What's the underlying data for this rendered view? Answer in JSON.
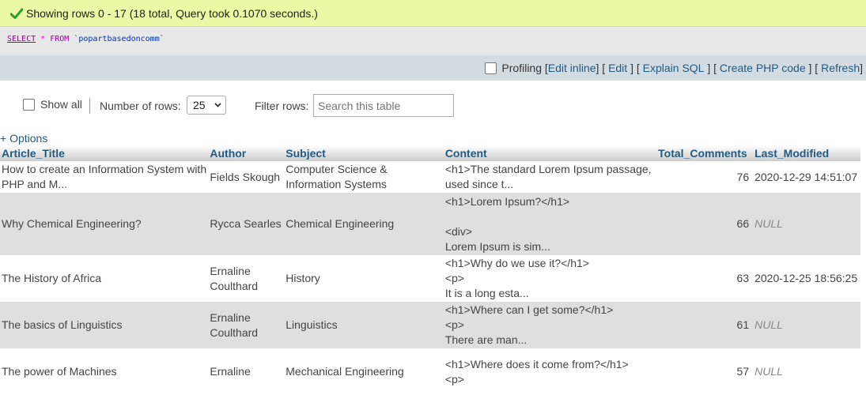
{
  "success": {
    "message": "Showing rows 0 - 17 (18 total, Query took 0.1070 seconds.)"
  },
  "sql": {
    "select": "SELECT",
    "star": "*",
    "from": "FROM",
    "table": "`popartbasedoncomm`"
  },
  "actions": {
    "profiling": "Profiling",
    "edit_inline": "Edit inline",
    "edit": "Edit",
    "explain": "Explain SQL",
    "create_php": "Create PHP code",
    "refresh": "Refresh"
  },
  "nav": {
    "show_all": "Show all",
    "rows_label": "Number of rows:",
    "rows_value": "25",
    "filter_label": "Filter rows:",
    "filter_placeholder": "Search this table"
  },
  "options_link": "+ Options",
  "table": {
    "headers": [
      "Article_Title",
      "Author",
      "Subject",
      "Content",
      "Total_Comments",
      "Last_Modified"
    ],
    "rows": [
      {
        "title": "How to create an Information System with PHP and M...",
        "author": "Fields Skough",
        "subject": "Computer Science & Information Systems",
        "content": "<h1>The standard Lorem Ipsum passage, used since t...",
        "comments": "76",
        "modified": "2020-12-29 14:51:07"
      },
      {
        "title": "Why Chemical Engineering?",
        "author": "Rycca Searles",
        "subject": "Chemical Engineering",
        "content": "<h1>Lorem Ipsum?</h1>\n\n<div>\nLorem Ipsum is sim...",
        "comments": "66",
        "modified": "NULL"
      },
      {
        "title": "The History of Africa",
        "author": "Ernaline Coulthard",
        "subject": "History",
        "content": "<h1>Why do we use it?</h1>\n<p>\nIt is a long esta...",
        "comments": "63",
        "modified": "2020-12-25 18:56:25"
      },
      {
        "title": "The basics of Linguistics",
        "author": "Ernaline Coulthard",
        "subject": "Linguistics",
        "content": "<h1>Where can I get some?</h1>\n<p>\nThere are man...",
        "comments": "61",
        "modified": "NULL"
      },
      {
        "title": "The power of Machines",
        "author": "Ernaline",
        "subject": "Mechanical Engineering",
        "content": "<h1>Where does it come from?</h1>\n<p>",
        "comments": "57",
        "modified": "NULL"
      }
    ]
  }
}
